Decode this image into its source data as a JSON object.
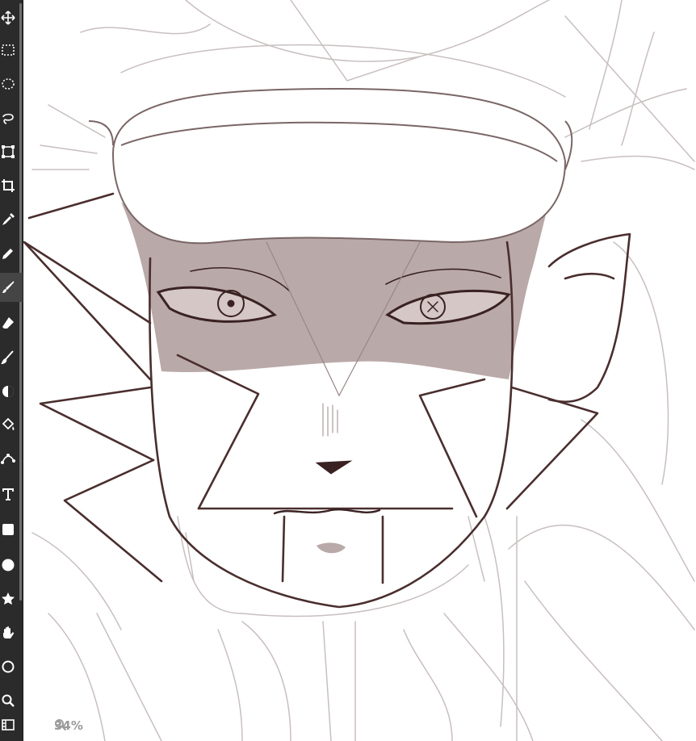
{
  "toolbar": {
    "tools": [
      {
        "name": "move-tool",
        "icon": "move-icon"
      },
      {
        "name": "rect-select-tool",
        "icon": "marquee-rect-icon"
      },
      {
        "name": "ellipse-select-tool",
        "icon": "marquee-ellipse-icon"
      },
      {
        "name": "lasso-tool",
        "icon": "lasso-icon"
      },
      {
        "name": "transform-tool",
        "icon": "transform-icon"
      },
      {
        "name": "crop-tool",
        "icon": "crop-icon"
      },
      {
        "name": "eyedropper-tool",
        "icon": "eyedropper-icon"
      },
      {
        "name": "pen-tool",
        "icon": "pen-icon"
      },
      {
        "name": "brush-tool",
        "icon": "brush-icon",
        "active": true
      },
      {
        "name": "eraser-tool",
        "icon": "eraser-icon"
      },
      {
        "name": "smudge-tool",
        "icon": "smudge-icon"
      },
      {
        "name": "blur-tool",
        "icon": "blur-icon"
      },
      {
        "name": "fill-tool",
        "icon": "paint-bucket-icon"
      },
      {
        "name": "vector-path-tool",
        "icon": "vector-path-icon"
      },
      {
        "name": "text-tool",
        "icon": "text-icon"
      },
      {
        "name": "rectangle-shape-tool",
        "icon": "square-icon"
      },
      {
        "name": "ellipse-shape-tool",
        "icon": "circle-icon"
      },
      {
        "name": "star-shape-tool",
        "icon": "star-icon"
      },
      {
        "name": "hand-tool",
        "icon": "hand-icon"
      },
      {
        "name": "rotate-view-tool",
        "icon": "rotate-icon"
      },
      {
        "name": "zoom-tool",
        "icon": "magnifier-icon"
      },
      {
        "name": "filmstrip-tool",
        "icon": "filmstrip-icon"
      }
    ]
  },
  "canvas": {
    "zoom_label": "34%",
    "line_color": "#4a2e2e",
    "sketch_color": "#c9bfbf",
    "shade_color": "#b9a9a8"
  }
}
